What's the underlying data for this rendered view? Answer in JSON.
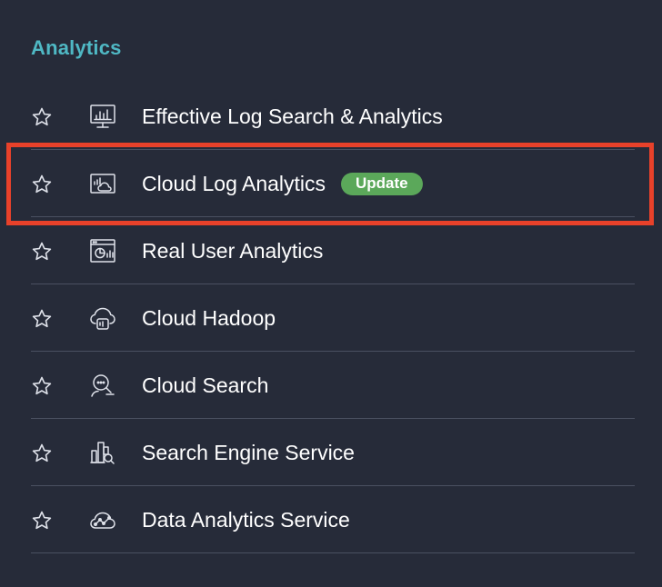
{
  "section": {
    "title": "Analytics"
  },
  "items": [
    {
      "label": "Effective Log Search & Analytics",
      "icon": "monitor-chart-icon",
      "badge": ""
    },
    {
      "label": "Cloud Log Analytics",
      "icon": "cloud-chart-icon",
      "badge": "Update"
    },
    {
      "label": "Real User Analytics",
      "icon": "browser-pie-icon",
      "badge": ""
    },
    {
      "label": "Cloud Hadoop",
      "icon": "cloud-database-icon",
      "badge": ""
    },
    {
      "label": "Cloud Search",
      "icon": "search-chat-icon",
      "badge": ""
    },
    {
      "label": "Search Engine Service",
      "icon": "buildings-search-icon",
      "badge": ""
    },
    {
      "label": "Data Analytics Service",
      "icon": "cloud-trend-icon",
      "badge": ""
    }
  ],
  "colors": {
    "background": "#262b39",
    "accent": "#4fb8c4",
    "badge": "#5ba85a",
    "highlight": "#e8412a",
    "divider": "#4a5061"
  }
}
